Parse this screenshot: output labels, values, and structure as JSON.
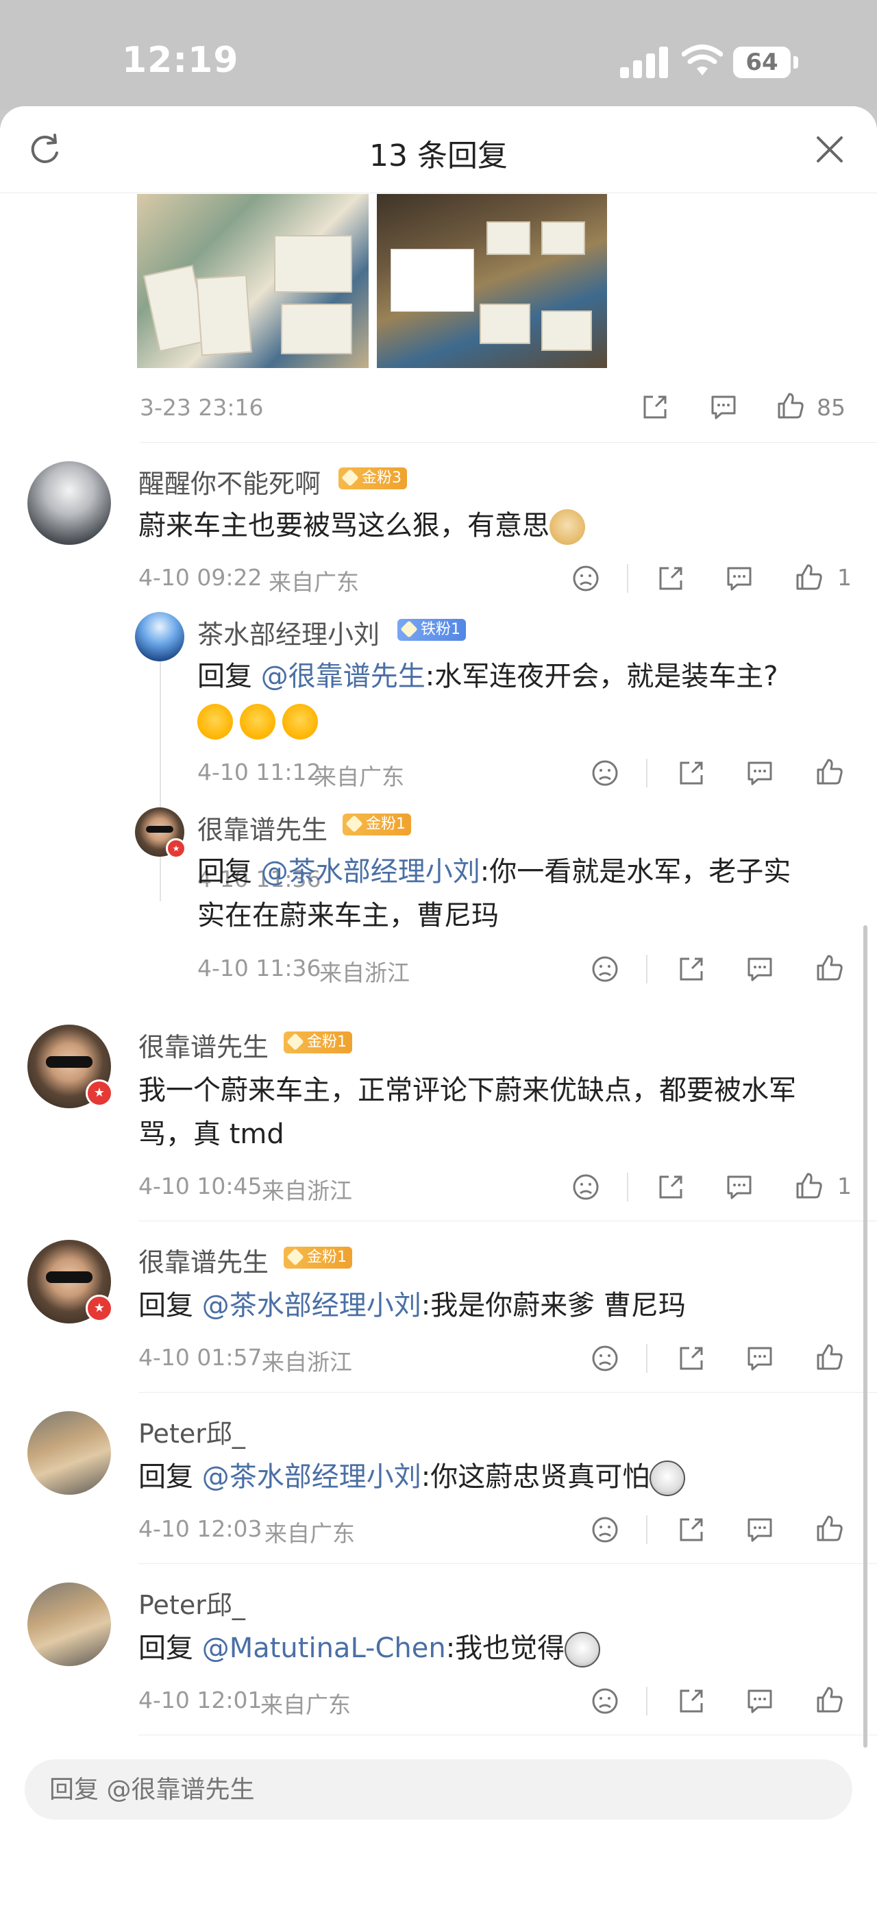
{
  "status": {
    "time": "12:19",
    "battery": "64"
  },
  "header": {
    "title": "13 条回复",
    "refresh_icon": "refresh-icon",
    "close_icon": "close-icon"
  },
  "top_post": {
    "timestamp": "3-23 23:16",
    "like_count": "85"
  },
  "comments": [
    {
      "name": "醒醒你不能死啊",
      "badge": "金粉3",
      "text": "蔚来车主也要被骂这么狠，有意思",
      "timestamp": "4-10 09:22",
      "location": "来自广东",
      "like_count": "1",
      "replies": [
        {
          "name": "茶水部经理小刘",
          "badge": "铁粉1",
          "prefix": "回复",
          "mention": "@很靠谱先生",
          "text": ":水军连夜开会，就是装车主?",
          "timestamp": "4-10 11:12",
          "location": "来自广东"
        },
        {
          "name": "很靠谱先生",
          "badge": "金粉1",
          "prefix": "回复",
          "mention": "@茶水部经理小刘",
          "text_line1": ":你一看就是水军，老子实",
          "text_line2": "实在在蔚来车主，曹尼玛",
          "timestamp": "4-10 11:36",
          "location": "来自浙江"
        }
      ]
    },
    {
      "name": "很靠谱先生",
      "badge": "金粉1",
      "text_line1": "我一个蔚来车主，正常评论下蔚来优缺点，都要被水军",
      "text_line2": "骂，真 tmd",
      "timestamp": "4-10 10:45",
      "location": "来自浙江",
      "like_count": "1"
    },
    {
      "name": "很靠谱先生",
      "badge": "金粉1",
      "prefix": "回复",
      "mention": "@茶水部经理小刘",
      "text": ":我是你蔚来爹 曹尼玛",
      "timestamp": "4-10 01:57",
      "location": "来自浙江"
    },
    {
      "name": "Peter邱_",
      "prefix": "回复",
      "mention": "@茶水部经理小刘",
      "text": ":你这蔚忠贤真可怕",
      "timestamp": "4-10 12:03",
      "location": "来自广东"
    },
    {
      "name": "Peter邱_",
      "prefix": "回复",
      "mention": "@MatutinaL-Chen",
      "text": ":我也觉得",
      "timestamp": "4-10 12:01",
      "location": "来自广东"
    }
  ],
  "reply_box": {
    "placeholder": "回复 @很靠谱先生"
  },
  "colors": {
    "mention": "#4a6fa5",
    "gold_badge": "#f0a22e",
    "iron_badge": "#5286e6",
    "meta_text": "#9a9a9a"
  }
}
